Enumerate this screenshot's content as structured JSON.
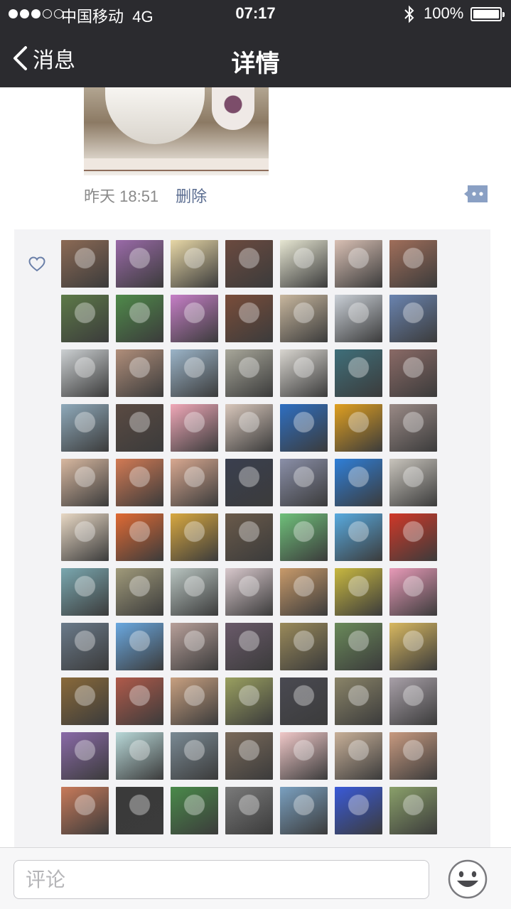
{
  "status_bar": {
    "carrier": "中国移动",
    "network": "4G",
    "time": "07:17",
    "battery": "100%",
    "signal_strength": 3
  },
  "nav": {
    "back_label": "消息",
    "title": "详情"
  },
  "post": {
    "time": "昨天 18:51",
    "delete_label": "删除"
  },
  "likes": {
    "avatars": [
      "#8c6a55",
      "#9a6aa8",
      "#e7d7a6",
      "#6b4a3f",
      "#e6e6d2",
      "#d9c0b4",
      "#a06e5a",
      "#5d7a48",
      "#4f8a4a",
      "#c67fc7",
      "#7a4d3a",
      "#c8b79e",
      "#c9cfd6",
      "#6a84b0",
      "#ccd0d2",
      "#b08e7a",
      "#9bb4c8",
      "#a8a79a",
      "#d8d5cf",
      "#3f6f7a",
      "#8a6a66",
      "#8faabb",
      "#5a4a42",
      "#f0a8b8",
      "#d8c7bb",
      "#2e6fc2",
      "#e0a020",
      "#9a8a86",
      "#d8b8a0",
      "#d27a54",
      "#d8a890",
      "#3a3f4f",
      "#8a8fa8",
      "#2f7fd8",
      "#c8c4bc",
      "#e8d8c4",
      "#e06a34",
      "#d8a840",
      "#6a5a4a",
      "#6fc07a",
      "#58aadf",
      "#d03828",
      "#7aa8b0",
      "#a09a7a",
      "#b8c4c0",
      "#d8c8cc",
      "#c89a6a",
      "#c8b840",
      "#e89ab8",
      "#6a7a8a",
      "#6aa8e0",
      "#b8a09a",
      "#6a5a6a",
      "#9a8a5a",
      "#6a8a5a",
      "#d8b860",
      "#8a6a3a",
      "#b05a4a",
      "#c8a080",
      "#9aa060",
      "#4a4a52",
      "#8a8468",
      "#a8a0a8",
      "#8a6aa8",
      "#b8d8d8",
      "#7a8a94",
      "#7a6a5a",
      "#f0c8c8",
      "#c8b098",
      "#c89a80",
      "#c87a5a",
      "#3a3a3a",
      "#4a8a4a",
      "#7a7a7a",
      "#7aa0c0",
      "#3a5ad8",
      "#8aa06a"
    ]
  },
  "bottom_bar": {
    "comment_placeholder": "评论"
  },
  "colors": {
    "nav_bg": "#2b2b2f",
    "link": "#5a6c90",
    "likes_bg": "#f3f3f5"
  }
}
